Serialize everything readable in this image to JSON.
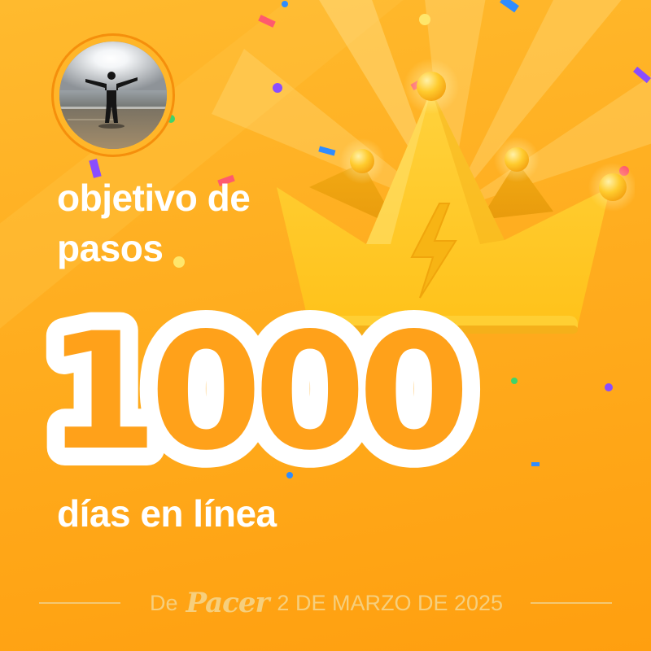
{
  "avatar": {
    "icon": "person-silhouette-beach-photo"
  },
  "badge": {
    "icon": "crown-lightning-icon"
  },
  "headline": {
    "line1": "objetivo de",
    "line2": "pasos"
  },
  "achievement": {
    "number": "1000",
    "subtitle": "días en línea"
  },
  "footer": {
    "prefix": "De",
    "brand": "Pacer",
    "date": "2 DE MARZO DE 2025"
  },
  "colors": {
    "background": "#ffad1f",
    "number_fill": "#ffa11a",
    "text": "#ffffff",
    "footer_text": "#f6cf7d"
  }
}
